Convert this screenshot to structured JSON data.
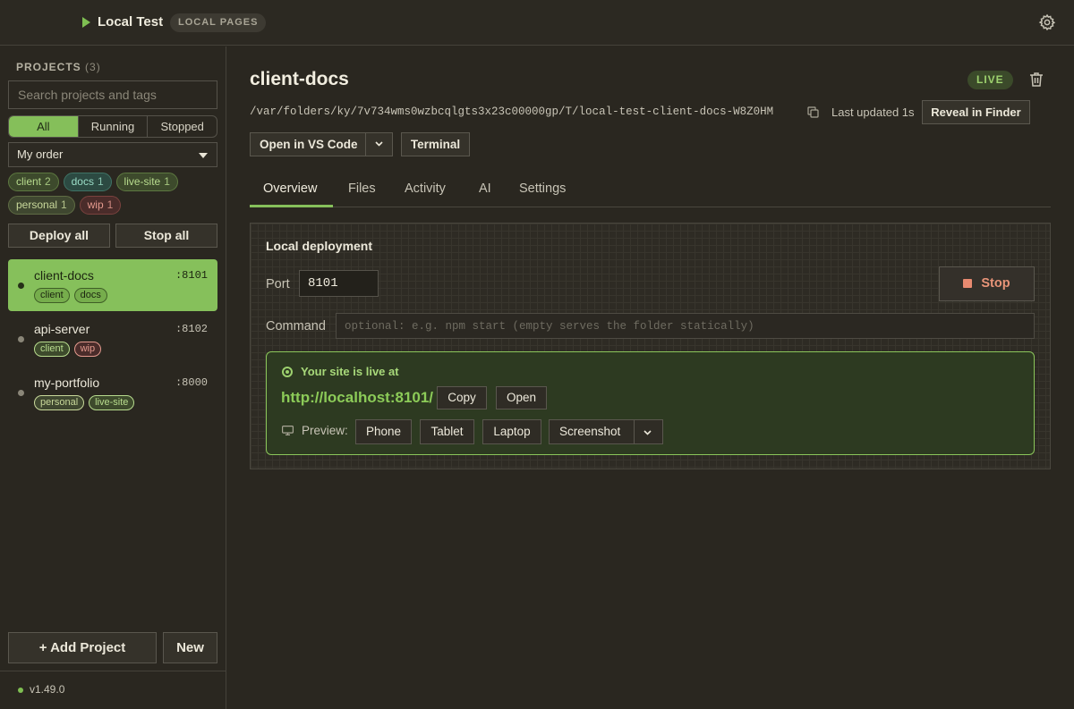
{
  "topbar": {
    "app_title": "Local Test",
    "badge": "LOCAL PAGES",
    "settings_icon": "gear-icon"
  },
  "sidebar": {
    "header": "PROJECTS",
    "count": "(3)",
    "search_placeholder": "Search projects and tags",
    "filters": [
      {
        "label": "All",
        "active": true
      },
      {
        "label": "Running",
        "active": false
      },
      {
        "label": "Stopped",
        "active": false
      }
    ],
    "order_value": "My order",
    "tags": [
      {
        "name": "client",
        "count": "2",
        "color": "green"
      },
      {
        "name": "docs",
        "count": "1",
        "color": "teal"
      },
      {
        "name": "live-site",
        "count": "1",
        "color": "green"
      },
      {
        "name": "personal",
        "count": "1",
        "color": "olive"
      },
      {
        "name": "wip",
        "count": "1",
        "color": "red"
      }
    ],
    "deploy_all": "Deploy all",
    "stop_all": "Stop all",
    "projects": [
      {
        "name": "client-docs",
        "port": ":8101",
        "tags": [
          "client",
          "docs"
        ],
        "active": true
      },
      {
        "name": "api-server",
        "port": ":8102",
        "tags": [
          "client",
          "wip"
        ],
        "active": false
      },
      {
        "name": "my-portfolio",
        "port": ":8000",
        "tags": [
          "personal",
          "live-site"
        ],
        "active": false
      }
    ],
    "add_project": "+ Add Project",
    "new": "New",
    "version": "v1.49.0"
  },
  "main": {
    "title": "client-docs",
    "status": "LIVE",
    "path": "/var/folders/ky/7v734wms0wzbcqlgts3x23c00000gp/T/local-test-client-docs-W8Z0HM",
    "last_updated": "Last updated 1s",
    "reveal": "Reveal in Finder",
    "open_vscode": "Open in VS Code",
    "terminal": "Terminal",
    "tabs": [
      {
        "label": "Overview",
        "active": true
      },
      {
        "label": "Files",
        "active": false
      },
      {
        "label": "Activity",
        "active": false
      },
      {
        "label": "AI",
        "active": false
      },
      {
        "label": "Settings",
        "active": false
      }
    ],
    "deployment": {
      "title": "Local deployment",
      "port_label": "Port",
      "port_value": "8101",
      "stop": "Stop",
      "command_label": "Command",
      "command_placeholder": "optional: e.g. npm start (empty serves the folder statically)",
      "live_heading": "Your site is live at",
      "url": "http://localhost:8101/",
      "copy": "Copy",
      "open": "Open",
      "preview_label": "Preview:",
      "preview_options": [
        "Phone",
        "Tablet",
        "Laptop",
        "Screenshot"
      ]
    }
  },
  "colors": {
    "accent": "#86c05b",
    "background": "#2a2720",
    "stop": "#e88a70"
  }
}
